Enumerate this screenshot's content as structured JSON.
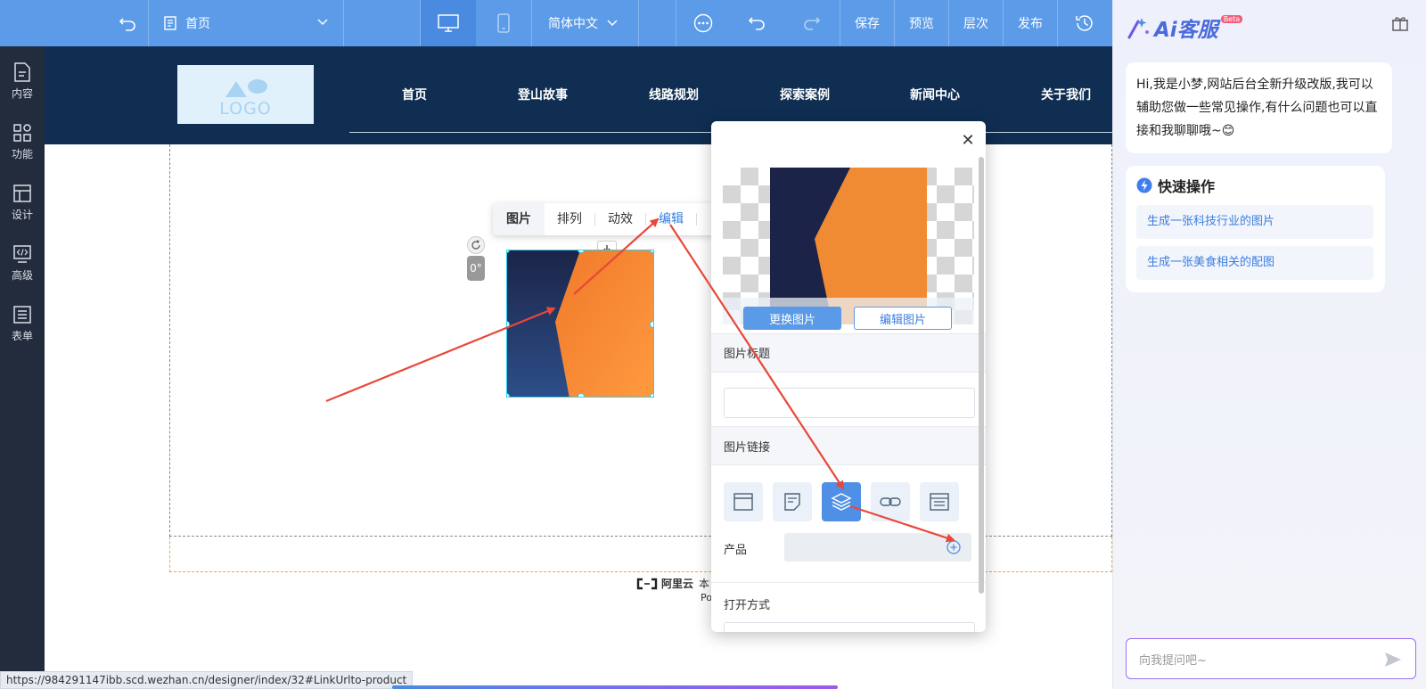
{
  "toolbar": {
    "page_name": "首页",
    "language": "简体中文",
    "save": "保存",
    "preview": "预览",
    "layers": "层次",
    "publish": "发布"
  },
  "sidebar": {
    "items": [
      {
        "label": "内容"
      },
      {
        "label": "功能"
      },
      {
        "label": "设计"
      },
      {
        "label": "高级"
      },
      {
        "label": "表单"
      }
    ]
  },
  "site": {
    "logo_text": "LOGO",
    "nav": [
      "首页",
      "登山故事",
      "线路规划",
      "探索案例",
      "新闻中心",
      "关于我们"
    ],
    "footer_brand": "阿里云",
    "footer_fragment_1": "本",
    "footer_fragment_2": "Po"
  },
  "image_toolbar": {
    "tabs": [
      "图片",
      "排列",
      "动效",
      "编辑"
    ]
  },
  "image_controls": {
    "rotation": "0°"
  },
  "popup": {
    "replace_button": "更换图片",
    "edit_button": "编辑图片",
    "title_label": "图片标题",
    "link_label": "图片链接",
    "product_label": "产品",
    "open_mode_label": "打开方式"
  },
  "ai": {
    "title": "Ai客服",
    "badge": "Beta",
    "greeting": "Hi,我是小梦,网站后台全新升级改版,我可以辅助您做一些常见操作,有什么问题也可以直接和我聊聊哦~😊",
    "quick_title": "快速操作",
    "quick_items": [
      "生成一张科技行业的图片",
      "生成一张美食相关的配图"
    ],
    "input_placeholder": "向我提问吧~"
  },
  "status": {
    "url": "https://984291147ibb.scd.wezhan.cn/designer/index/32#LinkUrlto-product"
  },
  "colors": {
    "toolbar": "#5b9be8",
    "sidebar": "#232c3d",
    "header": "#0f2e52",
    "accent": "#4f8fe6",
    "annotation_arrow": "#e8483a"
  }
}
